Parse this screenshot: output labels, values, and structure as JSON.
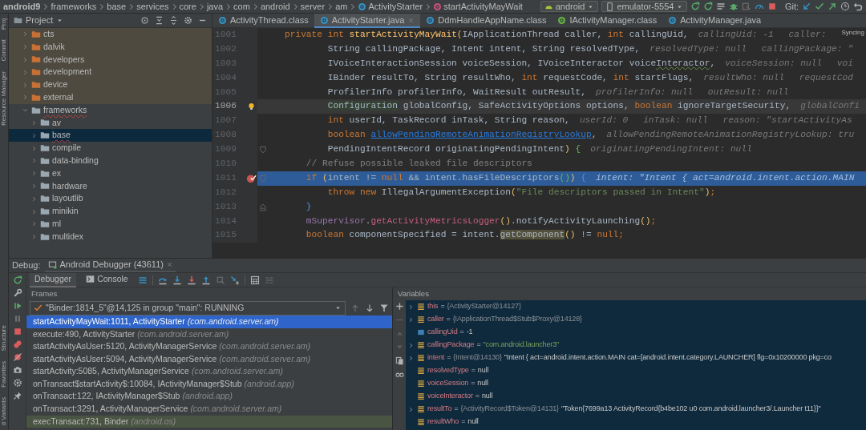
{
  "breadcrumb": [
    {
      "label": "android9",
      "kind": "project"
    },
    {
      "label": "frameworks",
      "kind": "folder"
    },
    {
      "label": "base",
      "kind": "folder"
    },
    {
      "label": "services",
      "kind": "folder"
    },
    {
      "label": "core",
      "kind": "folder"
    },
    {
      "label": "java",
      "kind": "folder"
    },
    {
      "label": "com",
      "kind": "folder"
    },
    {
      "label": "android",
      "kind": "folder"
    },
    {
      "label": "server",
      "kind": "folder"
    },
    {
      "label": "am",
      "kind": "folder"
    },
    {
      "label": "ActivityStarter",
      "kind": "class"
    },
    {
      "label": "startActivityMayWait",
      "kind": "method"
    }
  ],
  "run_config": {
    "label": "android"
  },
  "device": {
    "label": "emulator-5554"
  },
  "git_label": "Git:",
  "side_strip": {
    "top": [
      "Proj",
      "Commit",
      "Resource Manager"
    ],
    "bottom": [
      "Structure",
      "Favorites",
      "d Variants"
    ]
  },
  "project_panel": {
    "title": "Project",
    "tree": [
      {
        "label": "cts",
        "expanded": false,
        "selected": false,
        "excluded": true,
        "typo": false
      },
      {
        "label": "dalvik",
        "expanded": false,
        "selected": false,
        "excluded": true,
        "typo": false
      },
      {
        "label": "developers",
        "expanded": false,
        "selected": false,
        "excluded": true,
        "typo": false
      },
      {
        "label": "development",
        "expanded": false,
        "selected": false,
        "excluded": true,
        "typo": false
      },
      {
        "label": "device",
        "expanded": false,
        "selected": false,
        "excluded": true,
        "typo": false
      },
      {
        "label": "external",
        "expanded": false,
        "selected": false,
        "excluded": true,
        "typo": false
      },
      {
        "label": "frameworks",
        "expanded": true,
        "selected": false,
        "excluded": false,
        "typo": true,
        "children": [
          {
            "label": "av",
            "expanded": false,
            "selected": false,
            "excluded": false,
            "typo": false
          },
          {
            "label": "base",
            "expanded": false,
            "selected": true,
            "excluded": false,
            "typo": true
          },
          {
            "label": "compile",
            "expanded": false,
            "selected": false,
            "excluded": false,
            "typo": false
          },
          {
            "label": "data-binding",
            "expanded": false,
            "selected": false,
            "excluded": false,
            "typo": false
          },
          {
            "label": "ex",
            "expanded": false,
            "selected": false,
            "excluded": false,
            "typo": false
          },
          {
            "label": "hardware",
            "expanded": false,
            "selected": false,
            "excluded": false,
            "typo": false
          },
          {
            "label": "layoutlib",
            "expanded": false,
            "selected": false,
            "excluded": false,
            "typo": false
          },
          {
            "label": "minikin",
            "expanded": false,
            "selected": false,
            "excluded": false,
            "typo": false
          },
          {
            "label": "ml",
            "expanded": false,
            "selected": false,
            "excluded": false,
            "typo": false
          },
          {
            "label": "multidex",
            "expanded": false,
            "selected": false,
            "excluded": false,
            "typo": false
          }
        ]
      }
    ]
  },
  "editor_tabs": [
    {
      "label": "ActivityThread.class",
      "kind": "class",
      "selected": false
    },
    {
      "label": "ActivityStarter.java",
      "kind": "class",
      "selected": true
    },
    {
      "label": "DdmHandleAppName.class",
      "kind": "class",
      "selected": false
    },
    {
      "label": "IActivityManager.class",
      "kind": "interface",
      "selected": false
    },
    {
      "label": "ActivityManager.java",
      "kind": "class",
      "selected": false
    }
  ],
  "editor": {
    "status": "Syncing",
    "lines": [
      {
        "number": "1001",
        "kind": "signature",
        "caret": false,
        "execution": false,
        "bulb": false,
        "breakpoint": false,
        "fold_start": false,
        "fold_end": false,
        "code": [
          {
            "text": "private int ",
            "kind": "kw"
          },
          {
            "text": "startActivityMayWait",
            "kind": "fn"
          },
          {
            "text": "(",
            "kind": "paren"
          },
          {
            "text": "IApplicationThread caller, ",
            "kind": "plain"
          },
          {
            "text": "int ",
            "kind": "kw"
          },
          {
            "text": "callingUid,",
            "kind": "plain"
          }
        ],
        "hints": [
          "callingUid: -1",
          "caller:"
        ]
      },
      {
        "number": "1002",
        "kind": "parameter",
        "caret": false,
        "execution": false,
        "bulb": false,
        "breakpoint": false,
        "fold_start": false,
        "fold_end": false,
        "code": [
          {
            "text": "String callingPackage, Intent intent, String resolvedType,",
            "kind": "plain"
          }
        ],
        "hints": [
          "resolvedType: null",
          "callingPackage: \""
        ]
      },
      {
        "number": "1003",
        "kind": "parameter",
        "caret": false,
        "execution": false,
        "bulb": false,
        "breakpoint": false,
        "fold_start": false,
        "fold_end": false,
        "code": [
          {
            "text": "IVoiceInteractionSession voiceSession, IVoiceInteractor voice",
            "kind": "plain"
          },
          {
            "text": "Interactor",
            "kind": "warned"
          },
          {
            "text": ",",
            "kind": "plain"
          }
        ],
        "hints": [
          "voiceSession: null",
          "voi"
        ]
      },
      {
        "number": "1004",
        "kind": "parameter",
        "caret": false,
        "execution": false,
        "bulb": false,
        "breakpoint": false,
        "fold_start": false,
        "fold_end": false,
        "code": [
          {
            "text": "IBinder resultTo, String resultWho, ",
            "kind": "plain"
          },
          {
            "text": "int ",
            "kind": "kw"
          },
          {
            "text": "requestCode, ",
            "kind": "plain"
          },
          {
            "text": "int ",
            "kind": "kw"
          },
          {
            "text": "startFlags,",
            "kind": "plain"
          }
        ],
        "hints": [
          "resultWho: null",
          "requestCod"
        ]
      },
      {
        "number": "1005",
        "kind": "parameter",
        "caret": false,
        "execution": false,
        "bulb": false,
        "breakpoint": false,
        "fold_start": false,
        "fold_end": false,
        "code": [
          {
            "text": "ProfilerInfo profilerInfo, WaitResult outResult,",
            "kind": "plain"
          }
        ],
        "hints": [
          "profilerInfo: null",
          "outResult: null"
        ]
      },
      {
        "number": "1006",
        "kind": "parameter",
        "caret": true,
        "execution": false,
        "bulb": true,
        "breakpoint": false,
        "fold_start": false,
        "fold_end": false,
        "code": [
          {
            "text": "Configuration",
            "kind": "usage_type"
          },
          {
            "text": " globalConfig, SafeActivityOptions options, ",
            "kind": "plain"
          },
          {
            "text": "boolean ",
            "kind": "kw"
          },
          {
            "text": "ignoreTargetSecurity,",
            "kind": "plain"
          }
        ],
        "hints": [
          "globalConfi"
        ]
      },
      {
        "number": "1007",
        "kind": "parameter",
        "caret": false,
        "execution": false,
        "bulb": false,
        "breakpoint": false,
        "fold_start": false,
        "fold_end": false,
        "code": [
          {
            "text": "int ",
            "kind": "kw"
          },
          {
            "text": "userId, TaskRecord inTask, String reason,",
            "kind": "plain"
          }
        ],
        "hints": [
          "userId: 0",
          "inTask: null",
          "reason: \"startActivityAs"
        ]
      },
      {
        "number": "1008",
        "kind": "parameter",
        "caret": false,
        "execution": false,
        "bulb": false,
        "breakpoint": false,
        "fold_start": false,
        "fold_end": false,
        "code": [
          {
            "text": "boolean ",
            "kind": "kw"
          },
          {
            "text": "allowPendingRemoteAnimationRegistryLookup",
            "kind": "link"
          },
          {
            "text": ",",
            "kind": "plain"
          }
        ],
        "hints": [
          "allowPendingRemoteAnimationRegistryLookup: tru"
        ]
      },
      {
        "number": "1009",
        "kind": "parameter",
        "caret": false,
        "execution": false,
        "bulb": false,
        "breakpoint": false,
        "fold_start": true,
        "fold_end": false,
        "code": [
          {
            "text": "PendingIntentRecord originatingPendingIntent",
            "kind": "plain"
          },
          {
            "text": ")",
            "kind": "paren"
          },
          {
            "text": " {",
            "kind": "brace_green"
          }
        ],
        "hints": [
          "originatingPendingIntent: null"
        ]
      },
      {
        "number": "1010",
        "kind": "statement",
        "caret": false,
        "execution": false,
        "bulb": false,
        "breakpoint": false,
        "fold_start": false,
        "fold_end": false,
        "code": [
          {
            "text": "// Refuse possible leaked file descriptors",
            "kind": "comment"
          }
        ]
      },
      {
        "number": "1011",
        "kind": "statement",
        "caret": false,
        "execution": true,
        "bulb": false,
        "breakpoint": true,
        "fold_start": true,
        "fold_end": false,
        "code": [
          {
            "text": "if ",
            "kind": "kw"
          },
          {
            "text": "(",
            "kind": "paren"
          },
          {
            "text": "intent != ",
            "kind": "plain"
          },
          {
            "text": "null ",
            "kind": "kw"
          },
          {
            "text": "&& intent.hasFileDescriptors",
            "kind": "plain"
          },
          {
            "text": "()",
            "kind": "paren_green"
          },
          {
            "text": ")",
            "kind": "paren"
          },
          {
            "text": " {",
            "kind": "brace_blue"
          }
        ],
        "hints": [
          "intent: \"Intent { act=android.intent.action.MAIN"
        ]
      },
      {
        "number": "1012",
        "kind": "nested_statement",
        "caret": false,
        "execution": false,
        "bulb": false,
        "breakpoint": false,
        "fold_start": false,
        "fold_end": false,
        "code": [
          {
            "text": "throw new ",
            "kind": "kw"
          },
          {
            "text": "IllegalArgumentException",
            "kind": "plain"
          },
          {
            "text": "(",
            "kind": "paren"
          },
          {
            "text": "\"File descriptors passed in Intent\"",
            "kind": "string"
          },
          {
            "text": ")",
            "kind": "paren"
          },
          {
            "text": ";",
            "kind": "kw"
          }
        ]
      },
      {
        "number": "1013",
        "kind": "statement",
        "caret": false,
        "execution": false,
        "bulb": false,
        "breakpoint": false,
        "fold_start": false,
        "fold_end": true,
        "code": [
          {
            "text": "}",
            "kind": "brace_blue"
          }
        ]
      },
      {
        "number": "1014",
        "kind": "statement",
        "caret": false,
        "execution": false,
        "bulb": false,
        "breakpoint": false,
        "fold_start": false,
        "fold_end": false,
        "code": [
          {
            "text": "mSupervisor",
            "kind": "field"
          },
          {
            "text": ".",
            "kind": "plain"
          },
          {
            "text": "getActivityMetricsLogger",
            "kind": "call"
          },
          {
            "text": "()",
            "kind": "paren"
          },
          {
            "text": ".notifyActivityLaunching",
            "kind": "plain"
          },
          {
            "text": "()",
            "kind": "paren"
          },
          {
            "text": ";",
            "kind": "kw"
          }
        ]
      },
      {
        "number": "1015",
        "kind": "statement",
        "caret": false,
        "execution": false,
        "bulb": false,
        "breakpoint": false,
        "fold_start": false,
        "fold_end": false,
        "code": [
          {
            "text": "boolean ",
            "kind": "kw"
          },
          {
            "text": "componentSpecified = intent.",
            "kind": "plain"
          },
          {
            "text": "getComponent",
            "kind": "usage_call"
          },
          {
            "text": "()",
            "kind": "paren"
          },
          {
            "text": " != ",
            "kind": "plain"
          },
          {
            "text": "null",
            "kind": "kw"
          },
          {
            "text": ";",
            "kind": "kw"
          }
        ]
      }
    ]
  },
  "debug": {
    "label": "Debug:",
    "session_tab": {
      "label": "Android Debugger (43611)"
    },
    "tabs": [
      {
        "label": "Debugger",
        "kind": "debugger",
        "selected": true
      },
      {
        "label": "Console",
        "kind": "console",
        "selected": false
      }
    ],
    "frames": {
      "title": "Frames",
      "thread": "\"Binder:1814_5\"@14,125 in group \"main\": RUNNING",
      "items": [
        {
          "location": "startActivityMayWait:1011, ActivityStarter",
          "package": "(com.android.server.am)",
          "selected": true,
          "library": false
        },
        {
          "location": "execute:490, ActivityStarter",
          "package": "(com.android.server.am)",
          "selected": false,
          "library": false
        },
        {
          "location": "startActivityAsUser:5120, ActivityManagerService",
          "package": "(com.android.server.am)",
          "selected": false,
          "library": false
        },
        {
          "location": "startActivityAsUser:5094, ActivityManagerService",
          "package": "(com.android.server.am)",
          "selected": false,
          "library": false
        },
        {
          "location": "startActivity:5085, ActivityManagerService",
          "package": "(com.android.server.am)",
          "selected": false,
          "library": false
        },
        {
          "location": "onTransact$startActivity$:10084, IActivityManager$Stub",
          "package": "(android.app)",
          "selected": false,
          "library": false
        },
        {
          "location": "onTransact:122, IActivityManager$Stub",
          "package": "(android.app)",
          "selected": false,
          "library": false
        },
        {
          "location": "onTransact:3291, ActivityManagerService",
          "package": "(com.android.server.am)",
          "selected": false,
          "library": false
        },
        {
          "location": "execTransact:731, Binder",
          "package": "(android.os)",
          "selected": false,
          "library": true
        }
      ]
    },
    "variables": {
      "title": "Variables",
      "items": [
        {
          "kind": "object",
          "expandable": true,
          "parts": [
            {
              "text": "this",
              "kind": "name"
            },
            {
              "text": "=",
              "kind": "op"
            },
            {
              "text": "{ActivityStarter@14127}",
              "kind": "type"
            }
          ]
        },
        {
          "kind": "object",
          "expandable": true,
          "parts": [
            {
              "text": "caller",
              "kind": "name"
            },
            {
              "text": "=",
              "kind": "op"
            },
            {
              "text": "{IApplicationThread$Stub$Proxy@14128}",
              "kind": "type"
            }
          ]
        },
        {
          "kind": "primitive",
          "expandable": false,
          "parts": [
            {
              "text": "callingUid",
              "kind": "name"
            },
            {
              "text": "=",
              "kind": "op"
            },
            {
              "text": "-1",
              "kind": "value"
            }
          ]
        },
        {
          "kind": "object",
          "expandable": true,
          "parts": [
            {
              "text": "callingPackage",
              "kind": "name"
            },
            {
              "text": "=",
              "kind": "op"
            },
            {
              "text": "\"com.android.launcher3\"",
              "kind": "string"
            }
          ]
        },
        {
          "kind": "object",
          "expandable": true,
          "parts": [
            {
              "text": "intent",
              "kind": "name"
            },
            {
              "text": "=",
              "kind": "op"
            },
            {
              "text": "{Intent@14130}",
              "kind": "type"
            },
            {
              "text": "\"Intent { act=android.intent.action.MAIN cat=[android.intent.category.LAUNCHER] flg=0x10200000 pkg=co",
              "kind": "value"
            }
          ]
        },
        {
          "kind": "object",
          "expandable": false,
          "parts": [
            {
              "text": "resolvedType",
              "kind": "name"
            },
            {
              "text": "=",
              "kind": "op"
            },
            {
              "text": "null",
              "kind": "value"
            }
          ]
        },
        {
          "kind": "object",
          "expandable": false,
          "parts": [
            {
              "text": "voiceSession",
              "kind": "name"
            },
            {
              "text": "=",
              "kind": "op"
            },
            {
              "text": "null",
              "kind": "value"
            }
          ]
        },
        {
          "kind": "object",
          "expandable": false,
          "parts": [
            {
              "text": "voiceInteractor",
              "kind": "name"
            },
            {
              "text": "=",
              "kind": "op"
            },
            {
              "text": "null",
              "kind": "value"
            }
          ]
        },
        {
          "kind": "object",
          "expandable": true,
          "parts": [
            {
              "text": "resultTo",
              "kind": "name"
            },
            {
              "text": "=",
              "kind": "op"
            },
            {
              "text": "{ActivityRecord$Token@14131}",
              "kind": "type"
            },
            {
              "text": "\"Token{7699a13 ActivityRecord{b4be102 u0 com.android.launcher3/.Launcher t11}}\"",
              "kind": "value"
            }
          ]
        },
        {
          "kind": "object",
          "expandable": false,
          "parts": [
            {
              "text": "resultWho",
              "kind": "name"
            },
            {
              "text": "=",
              "kind": "op"
            },
            {
              "text": "null",
              "kind": "value"
            }
          ]
        }
      ]
    }
  }
}
